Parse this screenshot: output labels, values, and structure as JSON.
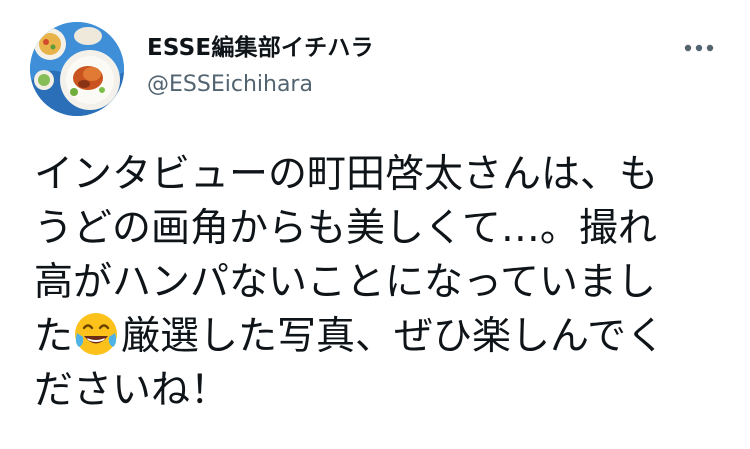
{
  "tweet": {
    "author": {
      "display_name": "ESSE編集部イチハラ",
      "handle": "@ESSEichihara",
      "avatar_icon": "food-plate-photo-avatar"
    },
    "more_icon": "more-horizontal-icon",
    "text_lines": [
      {
        "before": "インタビューの町田啓太さんは、も",
        "emoji": null,
        "after": ""
      },
      {
        "before": "うどの画角からも美しくて…。撮れ",
        "emoji": null,
        "after": ""
      },
      {
        "before": "高がハンパないことになっていまし",
        "emoji": null,
        "after": ""
      },
      {
        "before": "た",
        "emoji": "face-with-tears-of-joy-emoji",
        "after": "厳選した写真、ぜひ楽しんでく"
      },
      {
        "before": "ださいね！",
        "emoji": null,
        "after": ""
      }
    ],
    "colors": {
      "text": "#0f1419",
      "secondary": "#536471",
      "emoji_yellow": "#fcc21b",
      "emoji_tears": "#4fb3e8"
    }
  }
}
